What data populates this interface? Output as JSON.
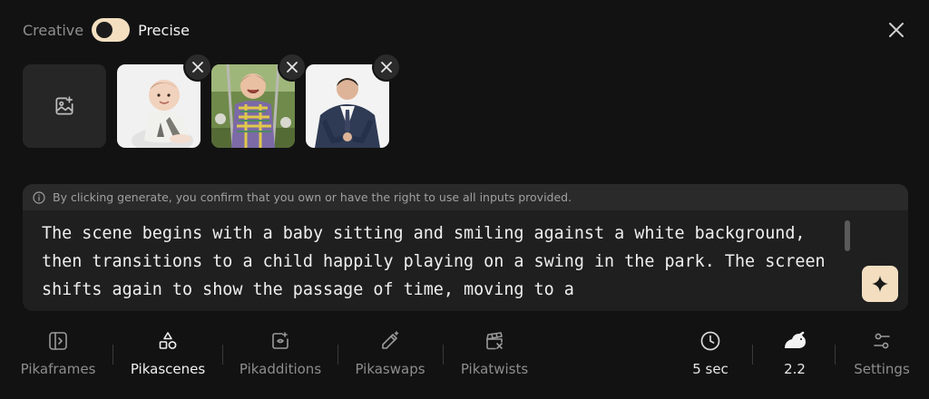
{
  "mode": {
    "left_label": "Creative",
    "right_label": "Precise",
    "selected": "Precise"
  },
  "header": {
    "close_icon": "close-icon"
  },
  "uploads": {
    "add_icon": "add-image-icon",
    "images": [
      {
        "name": "baby-photo",
        "remove_icon": "close-icon"
      },
      {
        "name": "child-swing-photo",
        "remove_icon": "close-icon"
      },
      {
        "name": "businessman-photo",
        "remove_icon": "close-icon"
      }
    ]
  },
  "prompt": {
    "notice": "By clicking generate, you confirm that you own or have the right to use all inputs provided.",
    "notice_icon": "info-icon",
    "text": "The scene begins with a baby sitting and smiling against a white background, then transitions to a child happily playing on a swing in the park. The screen shifts again to show the passage of time, moving to a",
    "enhance_icon": "sparkle-icon"
  },
  "tools": [
    {
      "label": "Pikaframes",
      "icon": "pikaframes-icon",
      "active": false
    },
    {
      "label": "Pikascenes",
      "icon": "pikascenes-icon",
      "active": true
    },
    {
      "label": "Pikadditions",
      "icon": "pikadditions-icon",
      "active": false
    },
    {
      "label": "Pikaswaps",
      "icon": "pikaswaps-icon",
      "active": false
    },
    {
      "label": "Pikatwists",
      "icon": "pikatwists-icon",
      "active": false
    }
  ],
  "settings": {
    "duration": "5 sec",
    "model": "2.2",
    "settings_label": "Settings"
  },
  "colors": {
    "accent": "#f3dfc0",
    "background": "#121212",
    "panel": "#1f1f1f"
  }
}
